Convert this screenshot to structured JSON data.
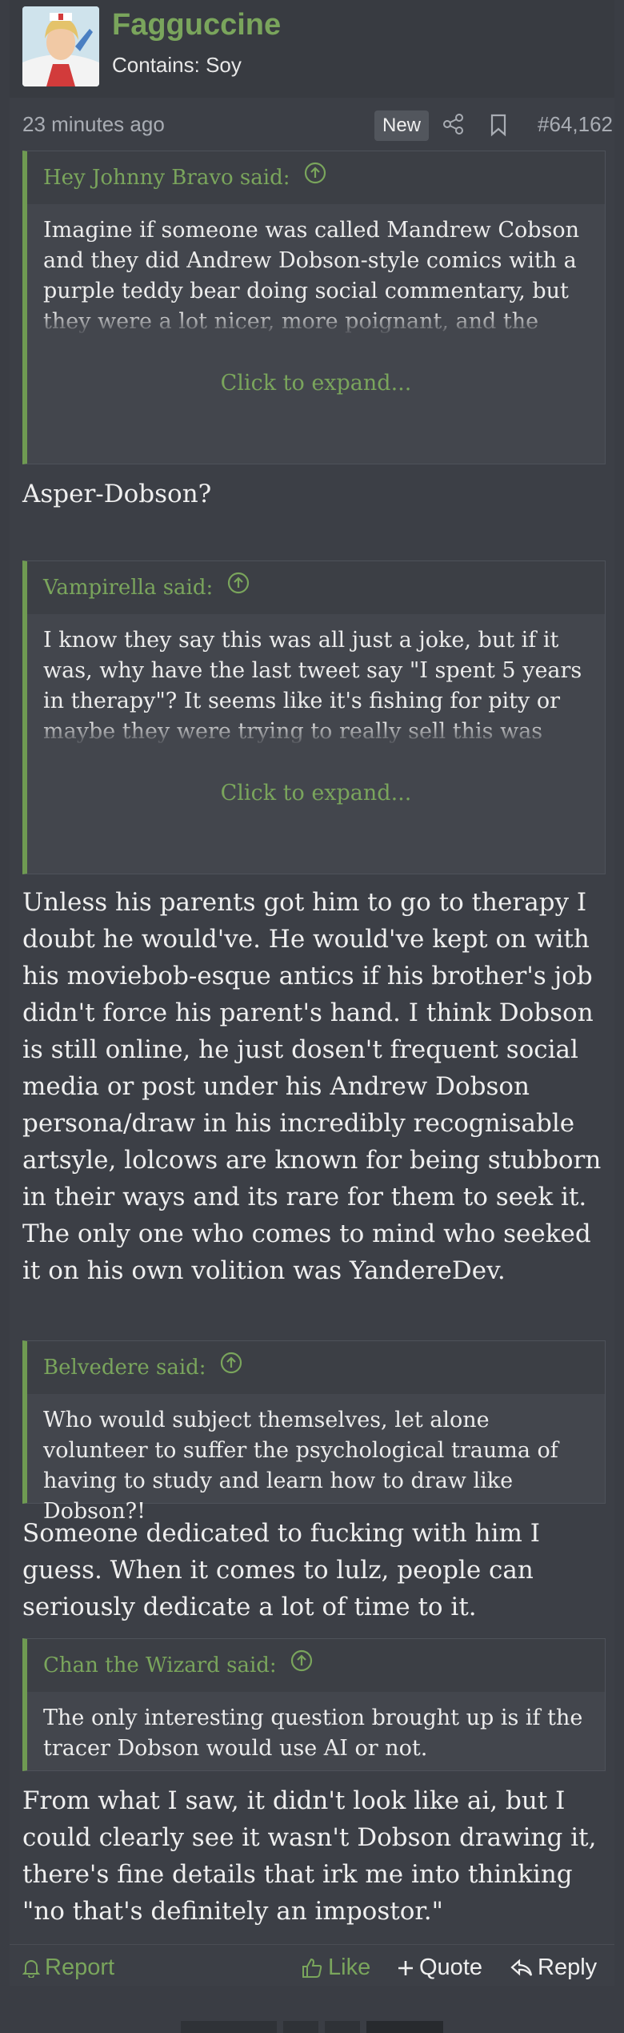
{
  "user": {
    "name": "Fagguccine",
    "title": "Contains: Soy"
  },
  "meta": {
    "time": "23 minutes ago",
    "badge": "New",
    "post_number": "#64,162"
  },
  "quotes": [
    {
      "author": "Hey Johnny Bravo said:",
      "text": "Imagine if someone was called Mandrew Cobson and they did Andrew Dobson-style comics with a purple teddy bear doing social commentary, but they were a lot nicer, more poignant, and the persona behind it was a kind and selfreflecting dude that",
      "expand": "Click to expand..."
    },
    {
      "author": "Vampirella said:",
      "text": "I know they say this was all just a joke, but if it was, why have the last tweet say \"I spent 5 years in therapy\"? It seems like it's fishing for pity or maybe they were trying to really sell this was Dobson. IDK about you, guys, but it sounds like the voice of",
      "expand": "Click to expand..."
    },
    {
      "author": "Belvedere said:",
      "text": "Who would subject themselves, let alone volunteer to suffer the psychological trauma of having to study and learn how to draw like Dobson?!"
    },
    {
      "author": "Chan the Wizard said:",
      "text": "The only interesting question brought up is if the tracer Dobson would use AI or not."
    }
  ],
  "replies": [
    "Asper-Dobson?",
    "Unless his parents got him to go to therapy I doubt he would've. He would've kept on with his moviebob-esque antics if his brother's job didn't force his parent's hand. I think Dobson is still online, he just dosen't frequent social media or post under his Andrew Dobson persona/draw in his incredibly recognisable artsyle, lolcows are known for being stubborn in their ways and its rare for them to seek it. The only one who comes to mind who seeked it on his own volition was YandereDev.",
    "Someone dedicated to fucking with him I guess. When it comes to lulz, people can seriously dedicate a lot of time to it.",
    "From what I saw, it didn't look like ai, but I could clearly see it wasn't Dobson drawing it, there's fine details that irk me into thinking \"no that's definitely an impostor.\""
  ],
  "actions": {
    "report": "Report",
    "like": "Like",
    "quote": "Quote",
    "reply": "Reply"
  },
  "colors": {
    "accent": "#7aa55c",
    "background": "#3c3f46",
    "quote_bg": "#43464d"
  }
}
